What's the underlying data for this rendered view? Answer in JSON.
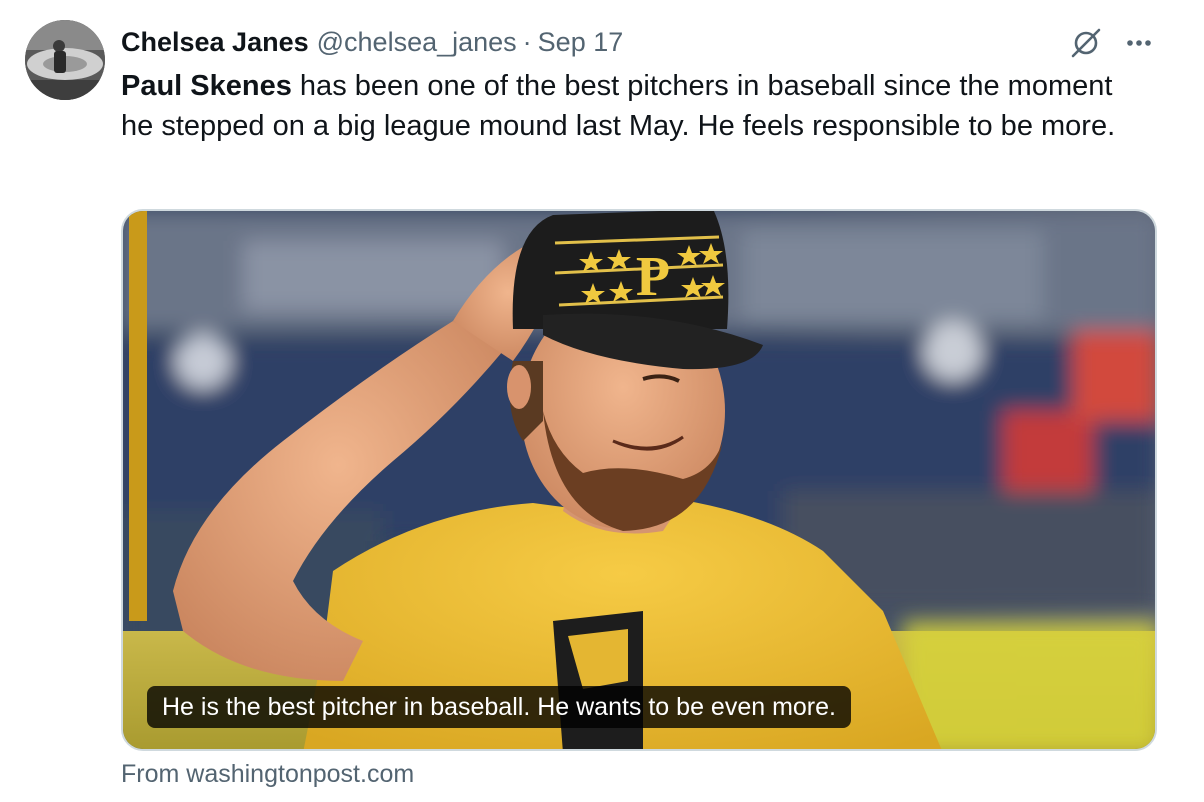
{
  "tweet": {
    "author_name": "Chelsea Janes",
    "author_handle": "@chelsea_janes",
    "separator": "·",
    "date": "Sep 17",
    "text_bold": "Paul Skenes",
    "text_rest": " has been one of the best pitchers in baseball since the moment he stepped on a big league mound last May. He feels responsible to be more."
  },
  "card": {
    "caption": "He is the best pitcher in baseball. He wants to be even more.",
    "source": "From washingtonpost.com",
    "cap_logo_letter": "P"
  },
  "icons": {
    "grok": "grok-icon",
    "more": "more-horizontal-icon"
  },
  "colors": {
    "text": "#0f1419",
    "secondary": "#536471",
    "border": "#cfd9de",
    "jersey_gold": "#f2c13a",
    "cap_black": "#1c1c1c"
  }
}
